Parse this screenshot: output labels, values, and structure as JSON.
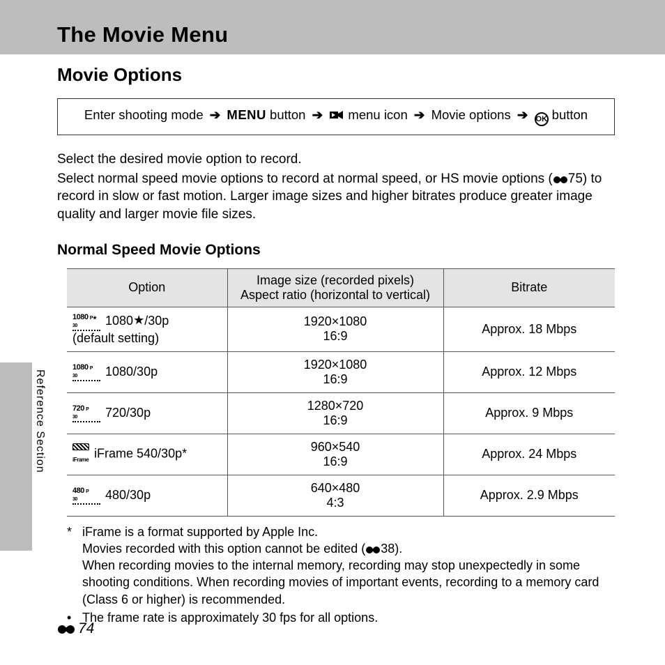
{
  "header": {
    "title": "The Movie Menu"
  },
  "section": {
    "title": "Movie Options",
    "nav": {
      "step1": "Enter shooting mode",
      "menu_word": "MENU",
      "step2": " button",
      "step3": " menu icon",
      "step4": "Movie options",
      "step5": " button"
    },
    "intro_p1": "Select the desired movie option to record.",
    "intro_p2a": "Select normal speed movie options to record at normal speed, or HS movie options (",
    "intro_p2_ref": "75",
    "intro_p2b": ") to record in slow or fast motion. Larger image sizes and higher bitrates produce greater image quality and larger movie file sizes.",
    "table_title": "Normal Speed Movie Options",
    "table": {
      "headers": {
        "col1": "Option",
        "col2a": "Image size (recorded pixels)",
        "col2b": "Aspect ratio (horizontal to vertical)",
        "col3": "Bitrate"
      },
      "rows": [
        {
          "icon_top": "1080",
          "icon_side": "P★30",
          "label": "1080★/30p",
          "note": "(default setting)",
          "size": "1920×1080",
          "ratio": "16:9",
          "bitrate": "Approx. 18 Mbps"
        },
        {
          "icon_top": "1080",
          "icon_side": "P 30",
          "label": "1080/30p",
          "note": "",
          "size": "1920×1080",
          "ratio": "16:9",
          "bitrate": "Approx. 12 Mbps"
        },
        {
          "icon_top": "720",
          "icon_side": "P 30",
          "label": "720/30p",
          "note": "",
          "size": "1280×720",
          "ratio": "16:9",
          "bitrate": "Approx. 9 Mbps"
        },
        {
          "icon_top": "iFrame",
          "icon_side": "",
          "label": "iFrame 540/30p*",
          "note": "",
          "size": "960×540",
          "ratio": "16:9",
          "bitrate": "Approx. 24 Mbps"
        },
        {
          "icon_top": "480",
          "icon_side": "P 30",
          "label": "480/30p",
          "note": "",
          "size": "640×480",
          "ratio": "4:3",
          "bitrate": "Approx. 2.9 Mbps"
        }
      ]
    },
    "footnotes": {
      "star_line1": "iFrame is a format supported by Apple Inc.",
      "star_line2a": "Movies recorded with this option cannot be edited (",
      "star_line2_ref": "38",
      "star_line2b": ").",
      "star_line3": "When recording movies to the internal memory, recording may stop unexpectedly in some shooting conditions. When recording movies of important events, recording to a memory card (Class 6 or higher) is recommended.",
      "bullet": "The frame rate is approximately 30 fps for all options."
    }
  },
  "side_label": "Reference Section",
  "page_number": "74"
}
